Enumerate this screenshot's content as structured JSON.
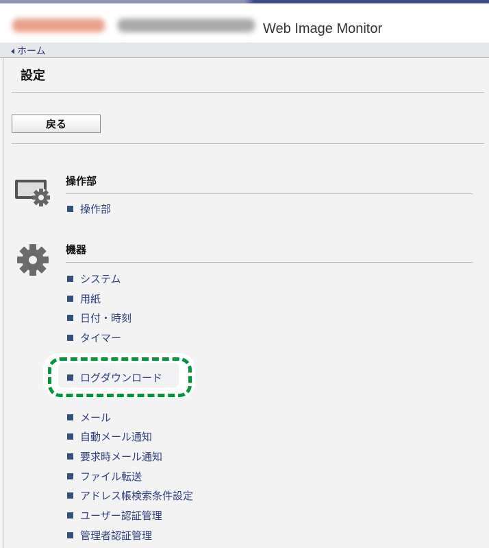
{
  "header": {
    "app_title": "Web Image Monitor"
  },
  "breadcrumb": {
    "home": "ホーム"
  },
  "page": {
    "title": "設定",
    "back_label": "戻る"
  },
  "sections": [
    {
      "heading": "操作部",
      "icon": "panel-gear-icon",
      "items": [
        "操作部"
      ]
    },
    {
      "heading": "機器",
      "icon": "gear-icon",
      "items": [
        "システム",
        "用紙",
        "日付・時刻",
        "タイマー",
        "ログダウンロード",
        "メール",
        "自動メール通知",
        "要求時メール通知",
        "ファイル転送",
        "アドレス帳検索条件設定",
        "ユーザー認証管理",
        "管理者認証管理"
      ]
    }
  ],
  "highlight": {
    "item": "ログダウンロード",
    "color": "#00963c"
  },
  "colors": {
    "link": "#2e3e7e",
    "bullet": "#33507f",
    "topbar": "#3d4c86"
  }
}
